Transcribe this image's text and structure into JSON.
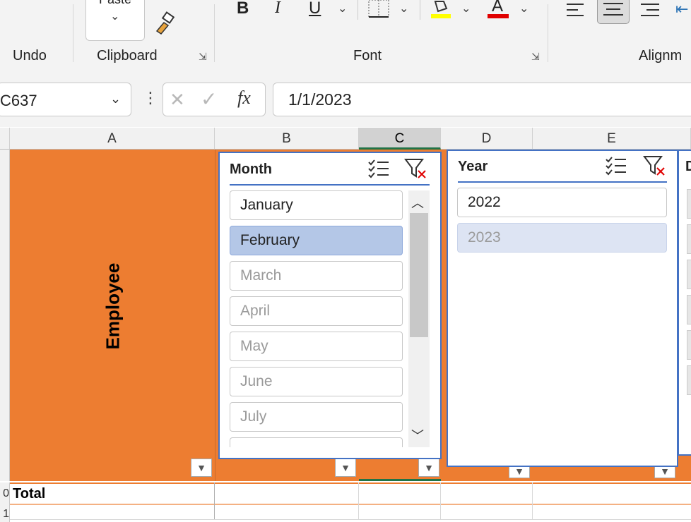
{
  "ribbon": {
    "groups": {
      "undo": "Undo",
      "clipboard": "Clipboard",
      "font": "Font",
      "alignment": "Alignm"
    },
    "paste_label": "Paste"
  },
  "formula_bar": {
    "name_box": "C637",
    "formula": "1/1/2023",
    "fx": "fx"
  },
  "columns": [
    "A",
    "B",
    "C",
    "D",
    "E"
  ],
  "selected_column": "C",
  "cells": {
    "header_label": "Employee",
    "total_label": "Total",
    "row_a": "0",
    "row_b": "1"
  },
  "slicers": {
    "month": {
      "title": "Month",
      "items": [
        {
          "label": "January",
          "state": "available"
        },
        {
          "label": "February",
          "state": "selected"
        },
        {
          "label": "March",
          "state": "no-data"
        },
        {
          "label": "April",
          "state": "no-data"
        },
        {
          "label": "May",
          "state": "no-data"
        },
        {
          "label": "June",
          "state": "no-data"
        },
        {
          "label": "July",
          "state": "no-data"
        }
      ]
    },
    "year": {
      "title": "Year",
      "items": [
        {
          "label": "2022",
          "state": "available"
        },
        {
          "label": "2023",
          "state": "selected-no-data"
        }
      ]
    },
    "partial": {
      "title": "D"
    }
  },
  "colors": {
    "accent_orange": "#ed7d31",
    "slicer_border": "#4472c4",
    "selected_item": "#b4c7e7",
    "excel_green": "#217346"
  }
}
